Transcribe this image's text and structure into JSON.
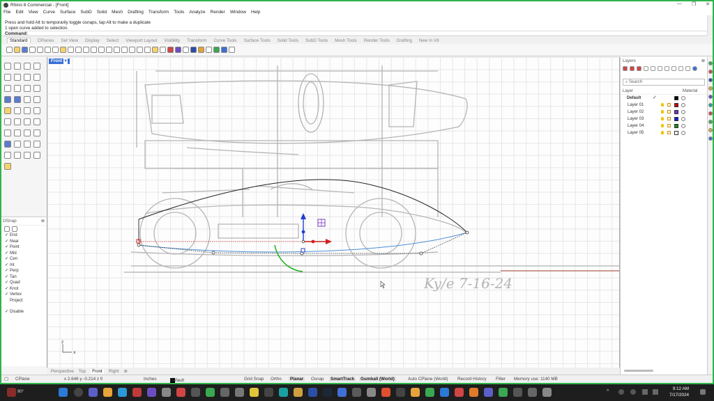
{
  "window": {
    "title": "Rhino 8 Commercial - [Front]",
    "min_glyph": "—",
    "max_glyph": "❐",
    "close_glyph": "✕"
  },
  "menu": [
    "File",
    "Edit",
    "View",
    "Curve",
    "Surface",
    "SubD",
    "Solid",
    "Mesh",
    "Drafting",
    "Transform",
    "Tools",
    "Analyze",
    "Render",
    "Window",
    "Help"
  ],
  "command_history": [
    "Press and hold Alt to temporarily toggle osnaps, tap Alt to make a duplicate",
    "1 open curve added to selection."
  ],
  "command_prompt": "Command:",
  "toolbar_tabs": [
    "Standard",
    "CPlanes",
    "Set View",
    "Display",
    "Select",
    "Viewport Layout",
    "Visibility",
    "Transform",
    "Curve Tools",
    "Surface Tools",
    "Solid Tools",
    "SubD Tools",
    "Mesh Tools",
    "Render Tools",
    "Drafting",
    "New in V8"
  ],
  "active_toolbar_tab": "Standard",
  "viewport": {
    "label": "Front",
    "dropdown_glyph": "▾",
    "handwriting": "Ky/e 7-16-24",
    "axis_x": "x",
    "axis_z": "z"
  },
  "view_tabs": [
    "Perspective",
    "Top",
    "Front",
    "Right"
  ],
  "active_view_tab": "Front",
  "add_tab_glyph": "⊕",
  "osnap": {
    "title": "OSnap",
    "close_glyph": "⊗",
    "items": [
      {
        "label": "End",
        "checked": true
      },
      {
        "label": "Near",
        "checked": true
      },
      {
        "label": "Point",
        "checked": true
      },
      {
        "label": "Mid",
        "checked": true
      },
      {
        "label": "Cen",
        "checked": true
      },
      {
        "label": "Int",
        "checked": true
      },
      {
        "label": "Perp",
        "checked": true
      },
      {
        "label": "Tan",
        "checked": true
      },
      {
        "label": "Quad",
        "checked": true
      },
      {
        "label": "Knot",
        "checked": true
      },
      {
        "label": "Vertex",
        "checked": true
      },
      {
        "label": "Project",
        "checked": false
      }
    ],
    "disable": {
      "label": "Disable",
      "checked": true
    },
    "check_glyph": "✓"
  },
  "layers": {
    "title": "Layers",
    "close_glyph": "⊗",
    "search_placeholder": "Search",
    "col_layer": "Layer",
    "col_material": "Material",
    "check_glyph": "✓",
    "rows": [
      {
        "name": "Default",
        "color": "#000000",
        "current": true
      },
      {
        "name": "Layer 01",
        "color": "#cc0000",
        "current": false
      },
      {
        "name": "Layer 02",
        "color": "#7b2bd6",
        "current": false
      },
      {
        "name": "Layer 03",
        "color": "#1a1ad6",
        "current": false
      },
      {
        "name": "Layer 04",
        "color": "#1f8a1f",
        "current": false
      },
      {
        "name": "Layer 05",
        "color": "#ffffff",
        "current": false
      }
    ]
  },
  "status": {
    "cplane": "CPlane",
    "coords": "x 2.646  y -0.214  z 0",
    "units": "Inches",
    "layer": "Default",
    "grid_snap": "Grid Snap",
    "ortho": "Ortho",
    "planar": "Planar",
    "osnap": "Osnap",
    "smarttrack": "SmartTrack",
    "gumball": "Gumball (World)",
    "auto_cplane": "Auto CPlane (World)",
    "record_history": "Record History",
    "filter": "Filter",
    "memory": "Memory use: 1140 MB"
  },
  "taskbar": {
    "time": "9:12 AM",
    "date": "7/17/2024",
    "weather": "90°",
    "up_glyph": "^"
  }
}
